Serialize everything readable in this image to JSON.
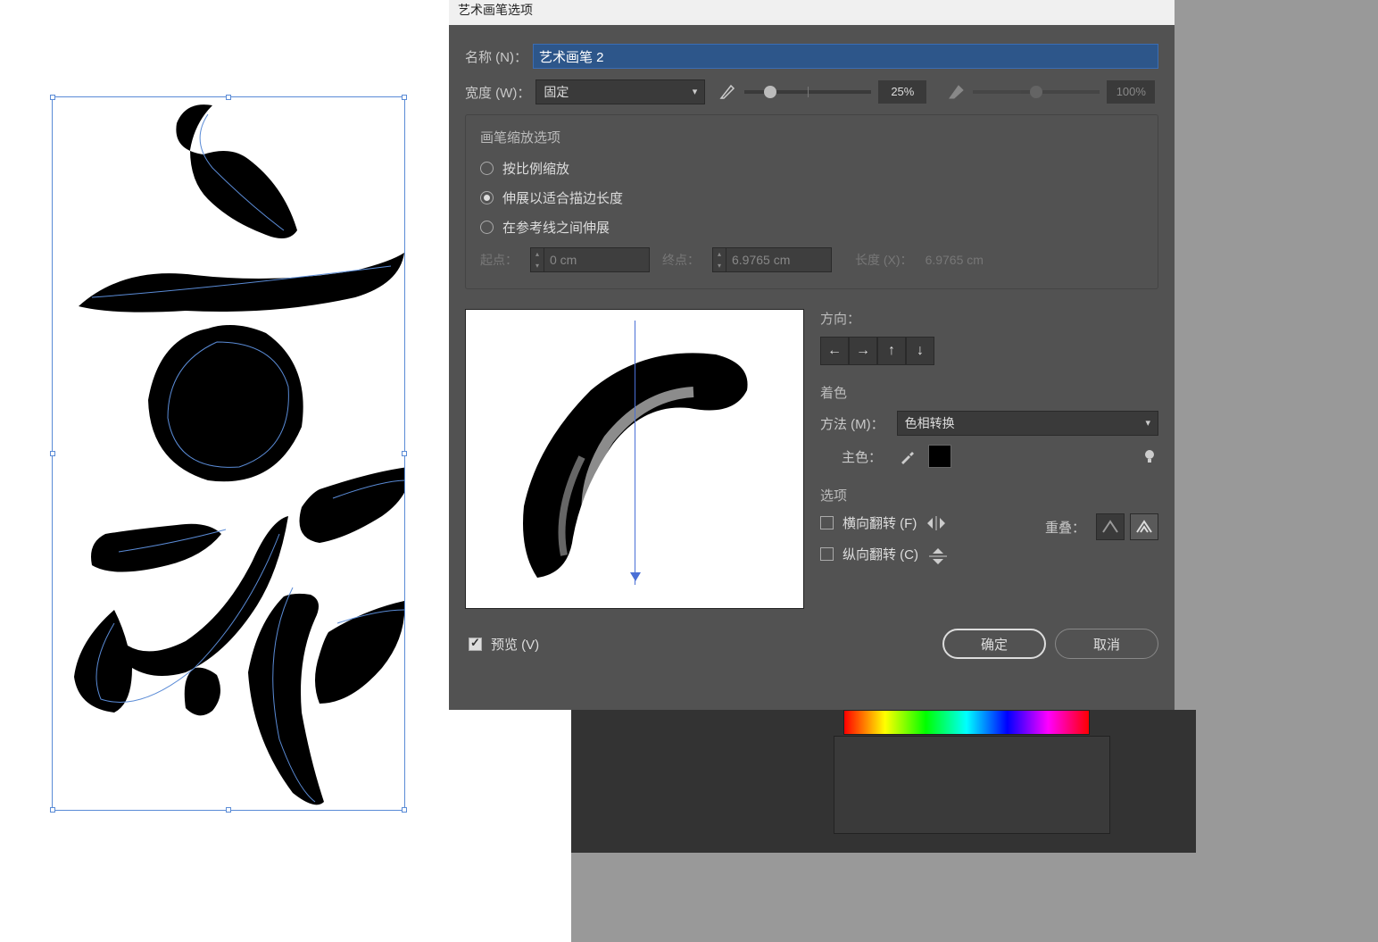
{
  "dialog": {
    "title": "艺术画笔选项",
    "name_label": "名称 (N)：",
    "name_value": "艺术画笔 2",
    "width_label": "宽度 (W)：",
    "width_mode": "固定",
    "width_pct": "25%",
    "width_pct2": "100%",
    "scale_panel": {
      "title": "画笔缩放选项",
      "opt_proportional": "按比例缩放",
      "opt_stretch": "伸展以适合描边长度",
      "opt_guides": "在参考线之间伸展",
      "start_label": "起点：",
      "start_value": "0 cm",
      "end_label": "终点：",
      "end_value": "6.9765 cm",
      "length_label": "长度 (X)：",
      "length_value": "6.9765 cm"
    },
    "direction_label": "方向：",
    "tint": {
      "title": "着色",
      "method_label": "方法 (M)：",
      "method_value": "色相转换",
      "keycolor_label": "主色："
    },
    "options": {
      "title": "选项",
      "flip_h": "横向翻转 (F)",
      "flip_v": "纵向翻转 (C)",
      "overlap_label": "重叠："
    },
    "preview_label": "预览 (V)",
    "ok": "确定",
    "cancel": "取消"
  }
}
